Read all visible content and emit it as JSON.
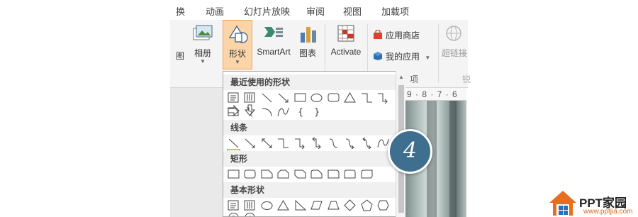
{
  "tabs": [
    "换",
    "动画",
    "幻灯片放映",
    "审阅",
    "视图",
    "加载项"
  ],
  "ribbon": {
    "partial_left_label": "图",
    "album_label": "相册",
    "shapes_label": "形状",
    "smartart_label": "SmartArt",
    "chart_label": "图表",
    "activate_label": "Activate",
    "store_label": "应用商店",
    "myapps_label": "我的应用",
    "hyperlink_label": "超链接",
    "group_apps_partial": "项",
    "group_links_partial": "锐"
  },
  "dropdown": {
    "recent_header": "最近使用的形状",
    "lines_header": "线条",
    "rect_header": "矩形",
    "basic_header": "基本形状"
  },
  "ruler": {
    "text": "9 · 8 · 7 · 6"
  },
  "badge": {
    "number": "4"
  },
  "logo": {
    "name": "PPT家园",
    "url": "www.pptjia.com"
  },
  "colors": {
    "active": "#fbd4a8",
    "badge": "#3e6f8f",
    "highlight": "#e68b62"
  }
}
